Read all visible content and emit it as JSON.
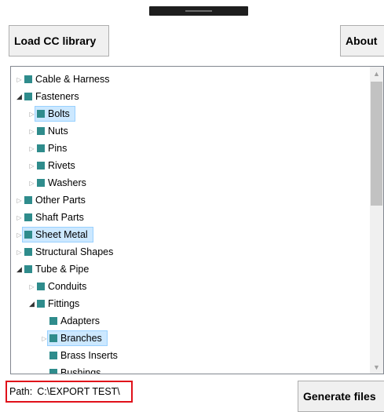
{
  "toolbar": {
    "load_label": "Load CC library",
    "about_label": "About"
  },
  "footer": {
    "path_label": "Path:",
    "path_value": "C:\\EXPORT TEST\\",
    "generate_label": "Generate files"
  },
  "tree": {
    "items": [
      {
        "label": "Cable & Harness",
        "level": 0,
        "expander": "collapsed"
      },
      {
        "label": "Fasteners",
        "level": 0,
        "expander": "expanded"
      },
      {
        "label": "Bolts",
        "level": 1,
        "expander": "collapsed",
        "selected": true
      },
      {
        "label": "Nuts",
        "level": 1,
        "expander": "collapsed"
      },
      {
        "label": "Pins",
        "level": 1,
        "expander": "collapsed"
      },
      {
        "label": "Rivets",
        "level": 1,
        "expander": "collapsed"
      },
      {
        "label": "Washers",
        "level": 1,
        "expander": "collapsed"
      },
      {
        "label": "Other Parts",
        "level": 0,
        "expander": "collapsed"
      },
      {
        "label": "Shaft Parts",
        "level": 0,
        "expander": "collapsed"
      },
      {
        "label": "Sheet Metal",
        "level": 0,
        "expander": "collapsed",
        "selected": true
      },
      {
        "label": "Structural Shapes",
        "level": 0,
        "expander": "collapsed"
      },
      {
        "label": "Tube & Pipe",
        "level": 0,
        "expander": "expanded"
      },
      {
        "label": "Conduits",
        "level": 1,
        "expander": "collapsed"
      },
      {
        "label": "Fittings",
        "level": 1,
        "expander": "expanded"
      },
      {
        "label": "Adapters",
        "level": 2,
        "expander": "none"
      },
      {
        "label": "Branches",
        "level": 2,
        "expander": "collapsed",
        "selected": true
      },
      {
        "label": "Brass Inserts",
        "level": 2,
        "expander": "none"
      },
      {
        "label": "Bushings",
        "level": 2,
        "expander": "none"
      }
    ]
  },
  "colors": {
    "node_icon": "#2f8c8c",
    "selection_bg": "#cce8ff",
    "selection_border": "#99d1ff",
    "path_highlight": "#e0101a"
  }
}
